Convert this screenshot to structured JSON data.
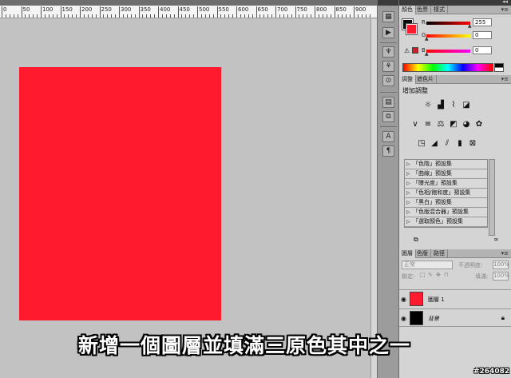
{
  "colors": {
    "document_fill": "#ff1a2e",
    "foreground_swatch": "#0a0a0a",
    "background_swatch": "#ff1a2e",
    "layer1_thumb": "#ff1a2e",
    "background_layer_thumb": "#000000"
  },
  "ruler": {
    "labels": [
      "0",
      "50",
      "100",
      "150",
      "200",
      "250",
      "300",
      "350",
      "400",
      "450",
      "500",
      "550",
      "600",
      "650",
      "700",
      "750",
      "800",
      "850",
      "900"
    ]
  },
  "color_panel": {
    "tabs": [
      "顏色",
      "色票",
      "樣式"
    ],
    "channels": [
      {
        "label": "R",
        "value": "255"
      },
      {
        "label": "G",
        "value": "0"
      },
      {
        "label": "B",
        "value": "0"
      }
    ]
  },
  "adjustments_panel": {
    "tabs": [
      "調整",
      "遮色片"
    ],
    "title": "增加調整",
    "icon_row1": [
      "brightness-icon",
      "levels-icon",
      "curves-icon",
      "exposure-icon"
    ],
    "icon_row2": [
      "vibrance-icon",
      "hue-saturation-icon",
      "color-balance-icon",
      "black-white-icon",
      "photo-filter-icon",
      "channel-mixer-icon"
    ],
    "icon_row3": [
      "invert-icon",
      "posterize-icon",
      "threshold-icon",
      "gradient-map-icon",
      "selective-color-icon"
    ],
    "presets": [
      "「色階」預設集",
      "「曲線」預設集",
      "「曝光度」預設集",
      "「色相/飽和度」預設集",
      "「黑白」預設集",
      "「色版混合器」預設集",
      "「選取顏色」預設集"
    ]
  },
  "layers_panel": {
    "tabs": [
      "圖層",
      "色版",
      "路徑"
    ],
    "blend_mode": "正常",
    "opacity_label": "不透明度:",
    "opacity_value": "100%",
    "lock_label": "鎖定:",
    "fill_label": "填滿:",
    "fill_value": "100%",
    "layers": [
      {
        "name": "圖層 1",
        "locked": false
      },
      {
        "name": "背景",
        "locked": true
      }
    ]
  },
  "subtitle": "新增一個圖層並填滿三原色其中之一",
  "watermark": "#264082"
}
